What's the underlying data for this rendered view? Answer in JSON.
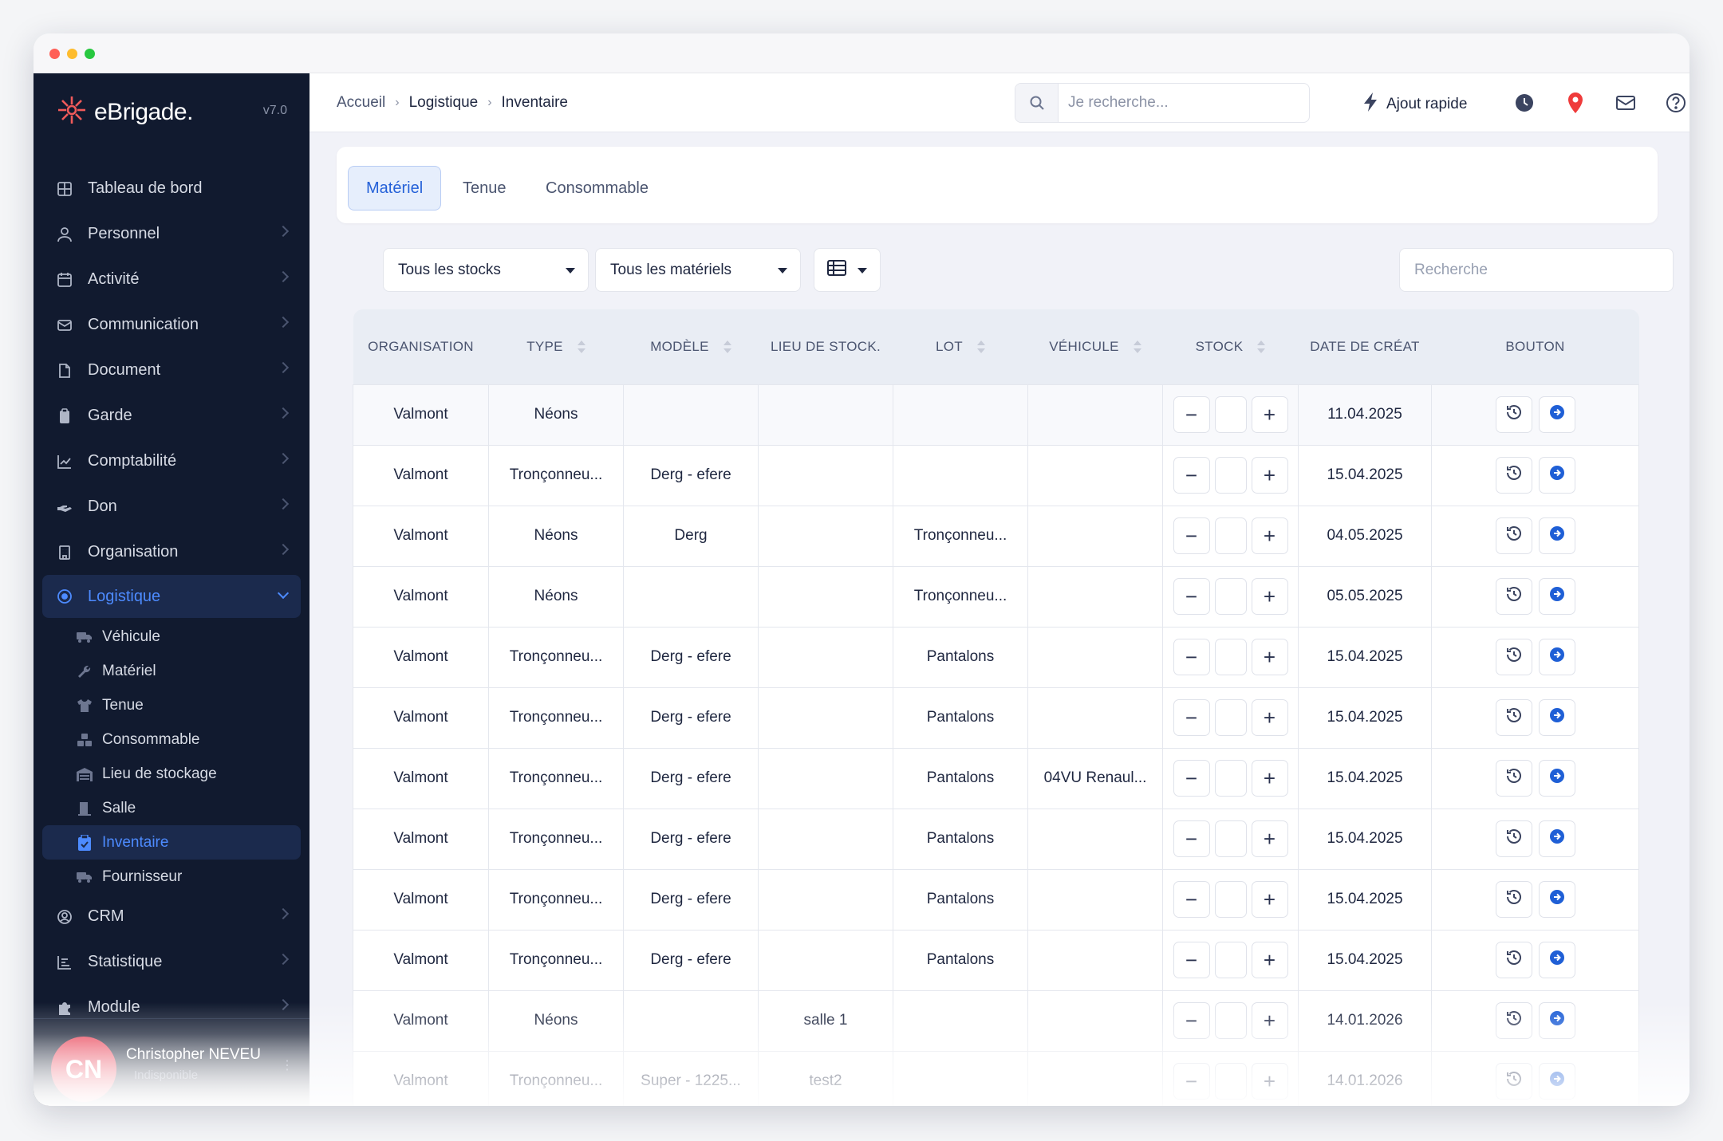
{
  "brand": {
    "name": "eBrigade.",
    "version": "v7.0"
  },
  "colors": {
    "accent": "#2561d8",
    "sidebar_bg": "#111a2f",
    "active_blue": "#4d8bff",
    "avatar_red": "#e83a4f"
  },
  "sidebar": {
    "items": [
      {
        "label": "Tableau de bord",
        "icon": "dashboard-icon"
      },
      {
        "label": "Personnel",
        "icon": "user-icon"
      },
      {
        "label": "Activité",
        "icon": "calendar-icon"
      },
      {
        "label": "Communication",
        "icon": "mail-icon"
      },
      {
        "label": "Document",
        "icon": "file-icon"
      },
      {
        "label": "Garde",
        "icon": "clipboard-icon"
      },
      {
        "label": "Comptabilité",
        "icon": "chart-icon"
      },
      {
        "label": "Don",
        "icon": "hand-icon"
      },
      {
        "label": "Organisation",
        "icon": "building-icon"
      },
      {
        "label": "Logistique",
        "icon": "target-icon"
      }
    ],
    "subitems": [
      {
        "label": "Véhicule",
        "icon": "truck-icon"
      },
      {
        "label": "Matériel",
        "icon": "wrench-icon"
      },
      {
        "label": "Tenue",
        "icon": "shirt-icon"
      },
      {
        "label": "Consommable",
        "icon": "boxes-icon"
      },
      {
        "label": "Lieu de stockage",
        "icon": "warehouse-icon"
      },
      {
        "label": "Salle",
        "icon": "door-icon"
      },
      {
        "label": "Inventaire",
        "icon": "clipboard-check-icon"
      },
      {
        "label": "Fournisseur",
        "icon": "truck-icon"
      }
    ],
    "items_after": [
      {
        "label": "CRM",
        "icon": "user-circle-icon"
      },
      {
        "label": "Statistique",
        "icon": "stats-icon"
      },
      {
        "label": "Module",
        "icon": "puzzle-icon"
      }
    ]
  },
  "user": {
    "initials": "CN",
    "name": "Christopher NEVEU",
    "status": "Indisponible"
  },
  "breadcrumb": {
    "home": "Accueil",
    "section": "Logistique",
    "page": "Inventaire"
  },
  "topbar": {
    "search_placeholder": "Je recherche...",
    "quick_add": "Ajout rapide"
  },
  "tabs": [
    "Matériel",
    "Tenue",
    "Consommable"
  ],
  "filters": {
    "stock": "Tous les stocks",
    "material": "Tous les matériels",
    "search_placeholder": "Recherche"
  },
  "table": {
    "headers": [
      "ORGANISATION",
      "TYPE",
      "MODÈLE",
      "LIEU DE STOCK.",
      "LOT",
      "VÉHICULE",
      "STOCK",
      "DATE DE CRÉAT",
      "BOUTON"
    ],
    "rows": [
      [
        "Valmont",
        "Néons",
        "",
        "",
        "",
        "",
        "",
        "11.04.2025"
      ],
      [
        "Valmont",
        "Tronçonneu...",
        "Derg - efere",
        "",
        "",
        "",
        "",
        "15.04.2025"
      ],
      [
        "Valmont",
        "Néons",
        "Derg",
        "",
        "Tronçonneu...",
        "",
        "",
        "04.05.2025"
      ],
      [
        "Valmont",
        "Néons",
        "",
        "",
        "Tronçonneu...",
        "",
        "",
        "05.05.2025"
      ],
      [
        "Valmont",
        "Tronçonneu...",
        "Derg - efere",
        "",
        "Pantalons",
        "",
        "",
        "15.04.2025"
      ],
      [
        "Valmont",
        "Tronçonneu...",
        "Derg - efere",
        "",
        "Pantalons",
        "",
        "",
        "15.04.2025"
      ],
      [
        "Valmont",
        "Tronçonneu...",
        "Derg - efere",
        "",
        "Pantalons",
        "04VU Renaul...",
        "",
        "15.04.2025"
      ],
      [
        "Valmont",
        "Tronçonneu...",
        "Derg - efere",
        "",
        "Pantalons",
        "",
        "",
        "15.04.2025"
      ],
      [
        "Valmont",
        "Tronçonneu...",
        "Derg - efere",
        "",
        "Pantalons",
        "",
        "",
        "15.04.2025"
      ],
      [
        "Valmont",
        "Tronçonneu...",
        "Derg - efere",
        "",
        "Pantalons",
        "",
        "",
        "15.04.2025"
      ],
      [
        "Valmont",
        "Néons",
        "",
        "salle 1",
        "",
        "",
        "",
        "14.01.2026"
      ],
      [
        "Valmont",
        "Tronçonneu...",
        "Super - 1225...",
        "test2",
        "",
        "",
        "",
        "14.01.2026"
      ]
    ]
  }
}
